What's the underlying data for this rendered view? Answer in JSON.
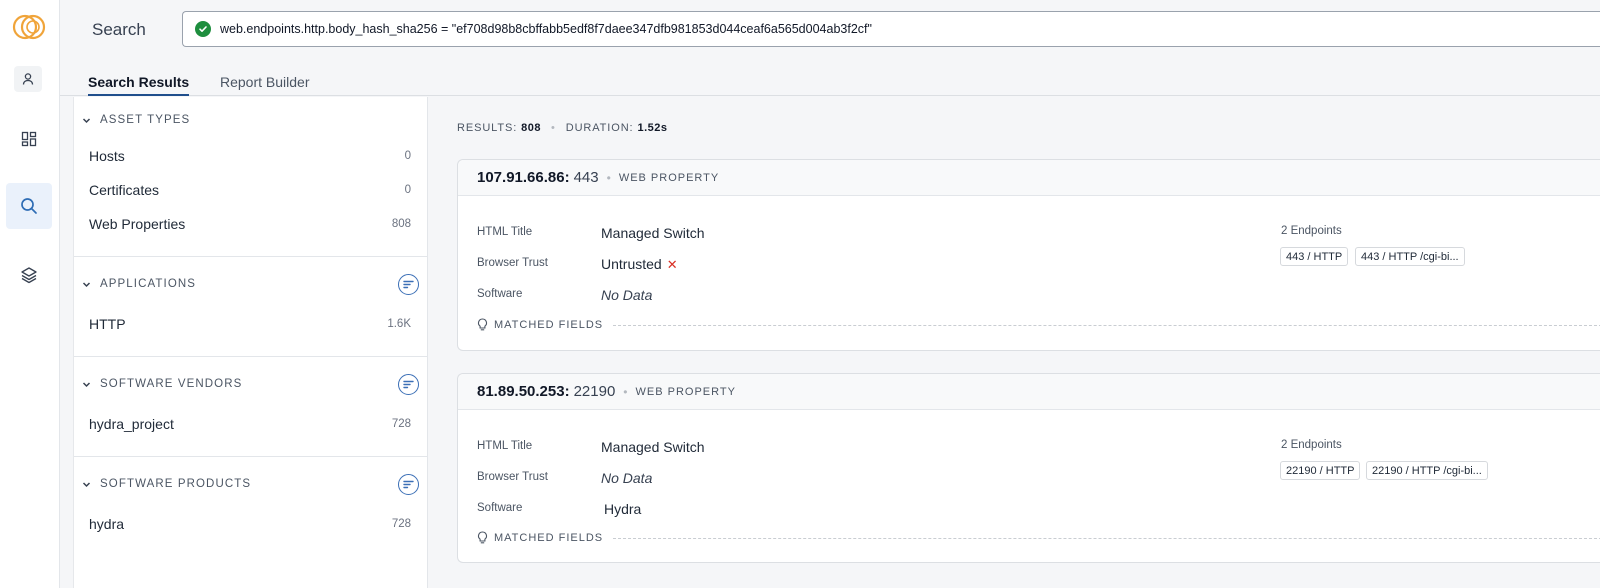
{
  "search": {
    "label": "Search",
    "query": "web.endpoints.http.body_hash_sha256 = \"ef708d98b8cbffabb5edf8f7daee347dfb981853d044ceaf6a565d004ab3f2cf\""
  },
  "tabs": [
    {
      "label": "Search Results",
      "active": true
    },
    {
      "label": "Report Builder",
      "active": false
    }
  ],
  "facets": [
    {
      "title": "ASSET TYPES",
      "sortable": false,
      "items": [
        {
          "name": "Hosts",
          "count": "0"
        },
        {
          "name": "Certificates",
          "count": "0"
        },
        {
          "name": "Web Properties",
          "count": "808"
        }
      ]
    },
    {
      "title": "APPLICATIONS",
      "sortable": true,
      "items": [
        {
          "name": "HTTP",
          "count": "1.6K"
        }
      ]
    },
    {
      "title": "SOFTWARE VENDORS",
      "sortable": true,
      "items": [
        {
          "name": "hydra_project",
          "count": "728"
        }
      ]
    },
    {
      "title": "SOFTWARE PRODUCTS",
      "sortable": true,
      "items": [
        {
          "name": "hydra",
          "count": "728"
        }
      ]
    }
  ],
  "summary": {
    "results_label": "RESULTS:",
    "results_value": "808",
    "duration_label": "DURATION:",
    "duration_value": "1.52s"
  },
  "field_labels": {
    "html_title": "HTML Title",
    "browser_trust": "Browser Trust",
    "software": "Software",
    "matched_fields": "MATCHED FIELDS"
  },
  "results": [
    {
      "ip": "107.91.66.86:",
      "port": "443",
      "kind": "WEB PROPERTY",
      "html_title": "Managed Switch",
      "browser_trust": "Untrusted",
      "browser_trust_nodata": false,
      "software": "No Data",
      "software_nodata": true,
      "endpoints_label": "2 Endpoints",
      "endpoints": [
        "443 / HTTP",
        "443 / HTTP /cgi-bi..."
      ]
    },
    {
      "ip": "81.89.50.253:",
      "port": "22190",
      "kind": "WEB PROPERTY",
      "html_title": "Managed Switch",
      "browser_trust": "No Data",
      "browser_trust_nodata": true,
      "software": "Hydra",
      "software_nodata": false,
      "endpoints_label": "2 Endpoints",
      "endpoints": [
        "22190 / HTTP",
        "22190 / HTTP /cgi-bi..."
      ]
    }
  ],
  "colors": {
    "accent": "#1f4e8c",
    "success": "#1e8e3e",
    "danger": "#d93025",
    "logo": "#f0a43a"
  }
}
